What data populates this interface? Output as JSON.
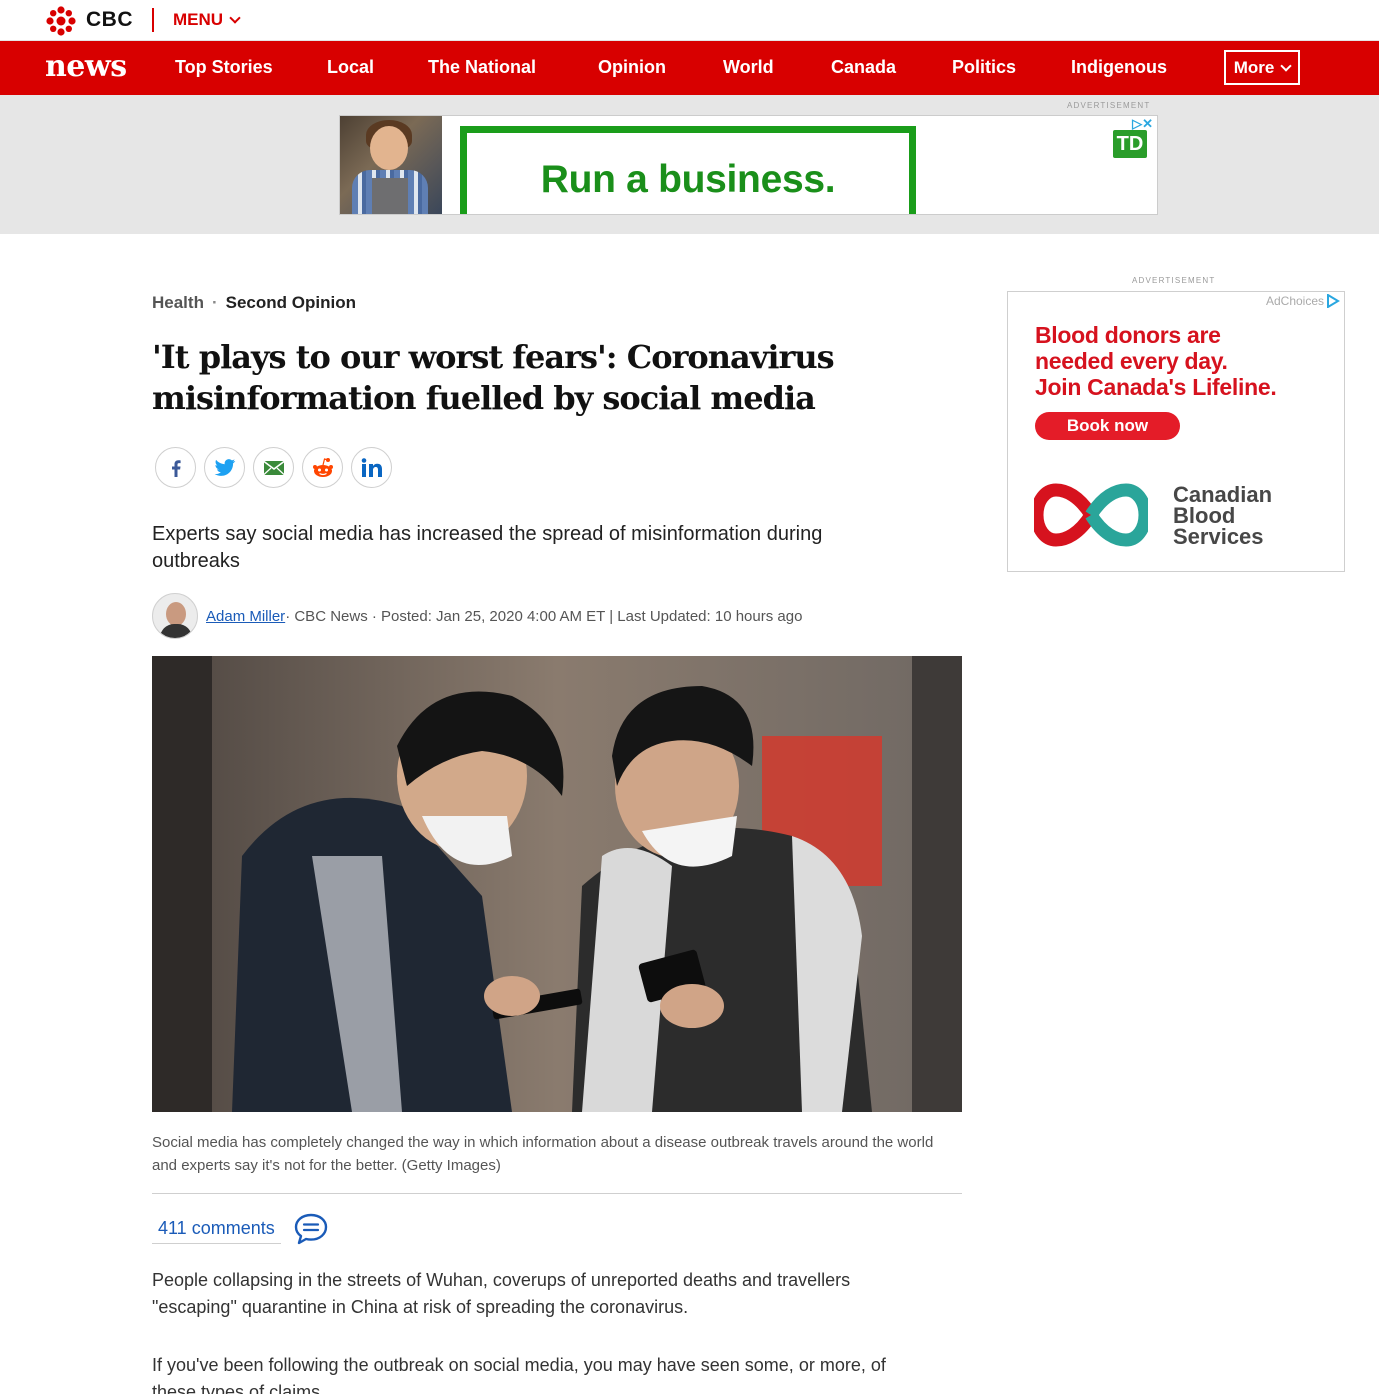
{
  "topbar": {
    "brand": "CBC",
    "menu_label": "MENU"
  },
  "navbar": {
    "logo": "news",
    "items": [
      "Top Stories",
      "Local",
      "The National",
      "Opinion",
      "World",
      "Canada",
      "Politics",
      "Indigenous"
    ],
    "more_label": "More"
  },
  "top_ad": {
    "label": "ADVERTISEMENT",
    "text": "Run a business.",
    "brand_logo": "TD",
    "colors": {
      "accent": "#1a9d1a"
    }
  },
  "article": {
    "section": "Health",
    "subsection": "Second Opinion",
    "headline": "'It plays to our worst fears': Coronavirus misinformation fuelled by social media",
    "share_icons": [
      "facebook-icon",
      "twitter-icon",
      "email-icon",
      "reddit-icon",
      "linkedin-icon"
    ],
    "deck": "Experts say social media has increased the spread of misinformation during outbreaks",
    "author": "Adam Miller",
    "byline_rest": " · CBC News · Posted: Jan 25, 2020 4:00 AM ET | Last Updated: 10 hours ago",
    "caption": "Social media has completely changed the way in which information about a disease outbreak travels around the world and experts say it's not for the better. (Getty Images)",
    "comments": "411 comments",
    "paragraphs": [
      "People collapsing in the streets of Wuhan, coverups of unreported deaths and travellers \"escaping\" quarantine in China at risk of spreading the coronavirus.",
      "If you've been following the outbreak on social media, you may have seen some, or more, of these types of claims."
    ]
  },
  "right_ad": {
    "label": "ADVERTISEMENT",
    "adchoices": "AdChoices",
    "headline_line1": "Blood donors are",
    "headline_line2": "needed every day.",
    "headline_line3": "Join Canada's Lifeline.",
    "button": "Book now",
    "org_line1": "Canadian",
    "org_line2": "Blood",
    "org_line3": "Services",
    "colors": {
      "red": "#d6121e",
      "teal": "#2aa59a"
    }
  },
  "colors": {
    "brand_red": "#d80000",
    "link_blue": "#1a5bb8"
  }
}
